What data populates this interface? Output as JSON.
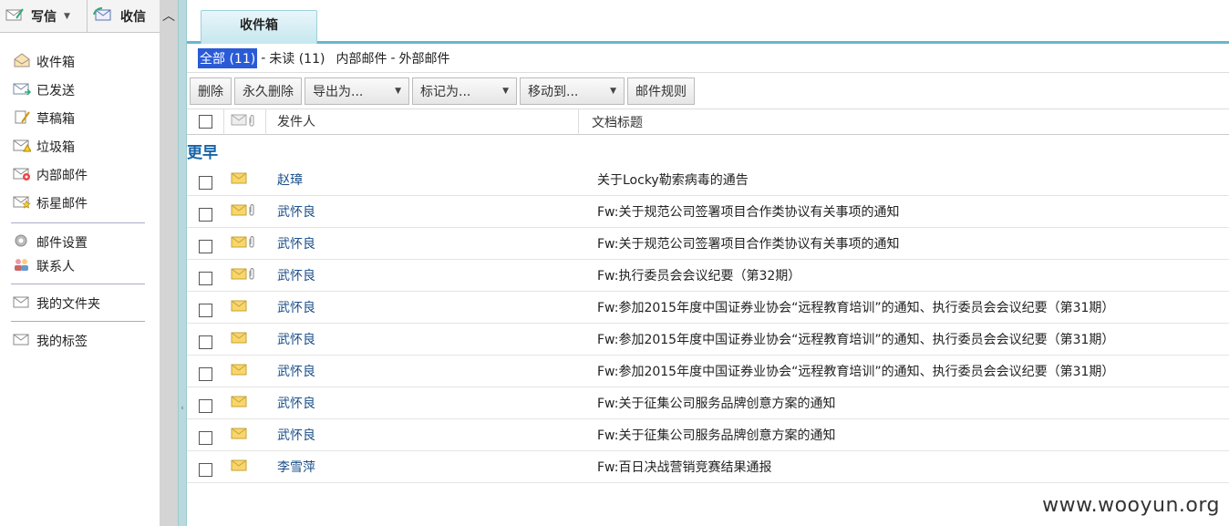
{
  "topbar": {
    "write_label": "写信",
    "receive_label": "收信"
  },
  "nav": {
    "items": [
      {
        "label": "收件箱",
        "icon": "inbox-icon"
      },
      {
        "label": "已发送",
        "icon": "sent-icon"
      },
      {
        "label": "草稿箱",
        "icon": "drafts-icon"
      },
      {
        "label": "垃圾箱",
        "icon": "trash-icon"
      },
      {
        "label": "内部邮件",
        "icon": "internal-mail-icon"
      },
      {
        "label": "标星邮件",
        "icon": "star-mail-icon"
      }
    ],
    "settings_label": "邮件设置",
    "contacts_label": "联系人",
    "folders_label": "我的文件夹",
    "tags_label": "我的标签"
  },
  "tab": {
    "label": "收件箱"
  },
  "filter": {
    "all": "全部 (11)",
    "sep1": "-",
    "unread": "未读 (11)",
    "internal": "内部邮件",
    "sep2": "-",
    "external": "外部邮件"
  },
  "toolbar": {
    "delete": "删除",
    "perm_delete": "永久删除",
    "export": "导出为...",
    "mark": "标记为...",
    "move": "移动到...",
    "rules": "邮件规则"
  },
  "table": {
    "col_sender": "发件人",
    "col_subject": "文档标题",
    "group": "更早",
    "rows": [
      {
        "sender": "赵璋",
        "subject": "关于Locky勒索病毒的通告"
      },
      {
        "sender": "武怀良",
        "subject": "Fw:关于规范公司签署项目合作类协议有关事项的通知"
      },
      {
        "sender": "武怀良",
        "subject": "Fw:关于规范公司签署项目合作类协议有关事项的通知"
      },
      {
        "sender": "武怀良",
        "subject": "Fw:执行委员会会议纪要（第32期）"
      },
      {
        "sender": "武怀良",
        "subject": "Fw:参加2015年度中国证券业协会“远程教育培训”的通知、执行委员会会议纪要（第31期）"
      },
      {
        "sender": "武怀良",
        "subject": "Fw:参加2015年度中国证券业协会“远程教育培训”的通知、执行委员会会议纪要（第31期）"
      },
      {
        "sender": "武怀良",
        "subject": "Fw:参加2015年度中国证券业协会“远程教育培训”的通知、执行委员会会议纪要（第31期）"
      },
      {
        "sender": "武怀良",
        "subject": "Fw:关于征集公司服务品牌创意方案的通知"
      },
      {
        "sender": "武怀良",
        "subject": "Fw:关于征集公司服务品牌创意方案的通知"
      },
      {
        "sender": "李雪萍",
        "subject": "Fw:百日决战营销竞赛结果通报"
      }
    ]
  },
  "watermark": "www.wooyun.org",
  "colors": {
    "accent": "#66b8cc",
    "link": "#1b4f8a",
    "group": "#1664a7",
    "selection": "#2a5bd7"
  }
}
